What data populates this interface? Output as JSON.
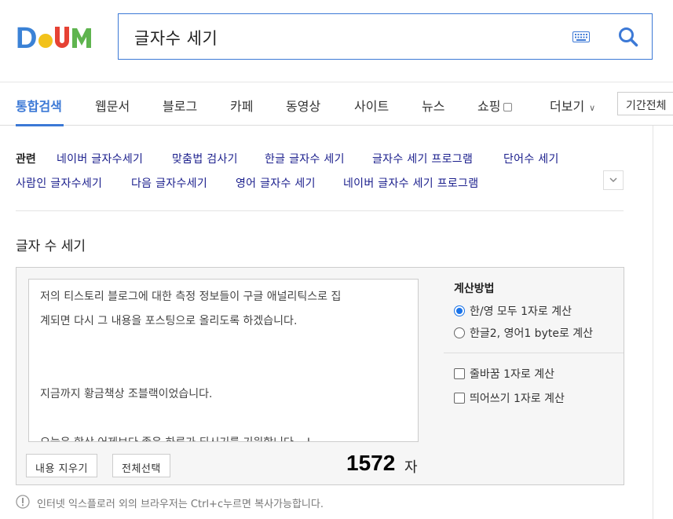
{
  "logo": {
    "text": "Daum",
    "colors": [
      "#3b82d6",
      "#f2c21b",
      "#e64234",
      "#5fb44f"
    ]
  },
  "search": {
    "query": "글자수 세기",
    "icons": [
      "keyboard-icon",
      "search-icon"
    ]
  },
  "nav": {
    "tabs": [
      "통합검색",
      "웹문서",
      "블로그",
      "카페",
      "동영상",
      "사이트",
      "뉴스",
      "쇼핑",
      "더보기"
    ],
    "active": "통합검색",
    "period": "기간전체"
  },
  "related": {
    "label": "관련",
    "items": [
      "네이버 글자수세기",
      "맞춤법 검사기",
      "한글 글자수 세기",
      "글자수 세기 프로그램",
      "단어수 세기",
      "사람인 글자수세기",
      "다음 글자수세기",
      "영어 글자수 세기",
      "네이버 글자수 세기 프로그램"
    ]
  },
  "counter": {
    "title": "글자 수 세기",
    "lines": [
      "저의 티스토리 블로그에 대한 측정 정보들이 구글 애널리틱스로 집",
      "계되면 다시 그 내용을 포스팅으로 올리도록 하겠습니다.",
      "",
      "",
      "지금까지 황금책상 조블랙이었습니다.",
      "",
      "오늘은 항상 어제보다 좋은 하루가 되시기를 기원합니다 ~!"
    ],
    "clear_label": "내용 지우기",
    "select_all_label": "전체선택",
    "count": "1572",
    "count_unit": "자",
    "method_title": "계산방법",
    "radio1": "한/영 모두 1자로 계산",
    "radio2": "한글2, 영어1 byte로 계산",
    "check1": "줄바꿈 1자로 계산",
    "check2": "띄어쓰기 1자로 계산",
    "selected_method": "한/영 모두 1자로 계산"
  },
  "notice": "인터넷 익스플로러 외의 브라우저는 Ctrl+c누르면 복사가능합니다.",
  "accent": "#3c79d6"
}
